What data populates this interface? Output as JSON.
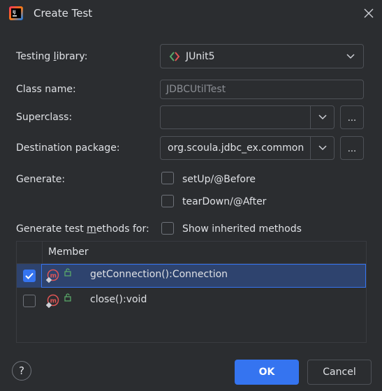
{
  "window": {
    "title": "Create Test"
  },
  "form": {
    "testing_library": {
      "label_pre": "Testing ",
      "label_mn": "l",
      "label_post": "ibrary:",
      "value": "JUnit5"
    },
    "class_name": {
      "label": "Class name:",
      "value": "JDBCUtilTest"
    },
    "superclass": {
      "label": "Superclass:",
      "value": "",
      "browse": "..."
    },
    "destination_package": {
      "label": "Destination package:",
      "value": "org.scoula.jdbc_ex.common",
      "browse": "..."
    },
    "generate": {
      "label": "Generate:",
      "options": [
        {
          "label": "setUp/@Before",
          "checked": false
        },
        {
          "label": "tearDown/@After",
          "checked": false
        }
      ]
    },
    "generate_methods": {
      "label_pre": "Generate test ",
      "label_mn": "m",
      "label_post": "ethods for:",
      "show_inherited": {
        "label": "Show inherited methods",
        "checked": false
      }
    }
  },
  "table": {
    "header": "Member",
    "rows": [
      {
        "method": "getConnection():Connection",
        "checked": true,
        "selected": true
      },
      {
        "method": "close():void",
        "checked": false,
        "selected": false
      }
    ]
  },
  "buttons": {
    "help": "?",
    "ok": "OK",
    "cancel": "Cancel"
  },
  "colors": {
    "background": "#2b2d30",
    "accent": "#3574f0",
    "selection": "#2e436e"
  }
}
